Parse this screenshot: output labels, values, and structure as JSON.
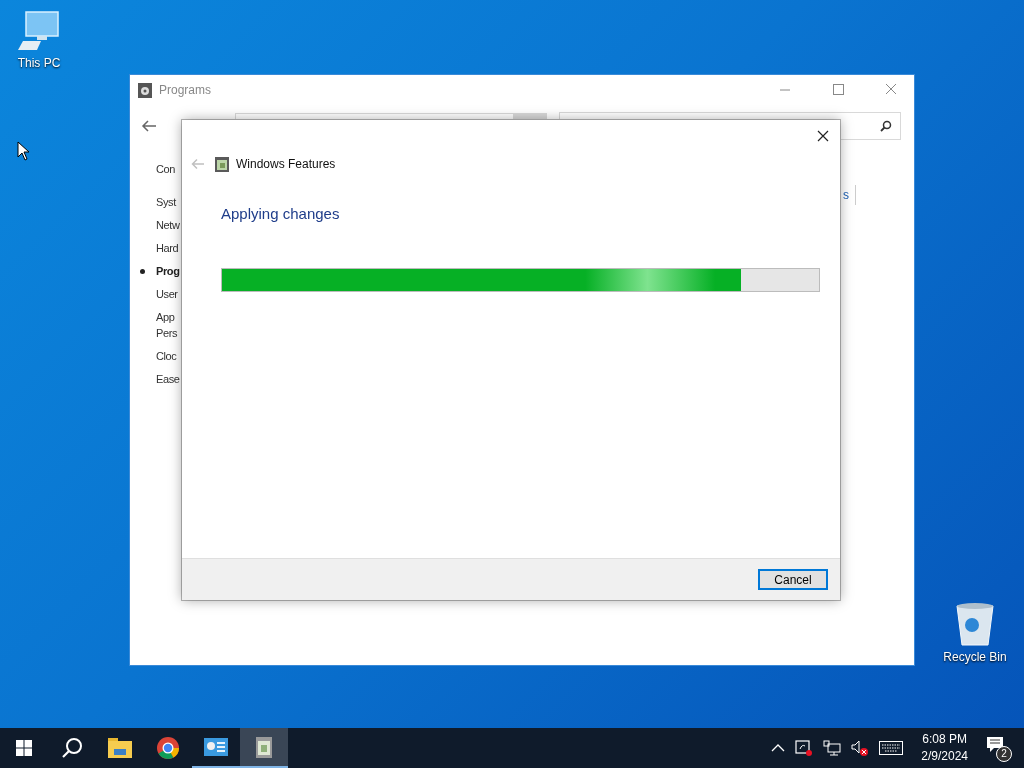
{
  "desktop_icons": [
    {
      "kind": "computer",
      "label": "This PC"
    },
    {
      "kind": "recycle",
      "label": "Recycle Bin"
    }
  ],
  "programs_window": {
    "title": "Programs",
    "sidebar_items": [
      {
        "lines": [
          "Con"
        ],
        "selected": false
      },
      {
        "lines": [
          "Syst"
        ],
        "selected": false
      },
      {
        "lines": [
          "Netw"
        ],
        "selected": false
      },
      {
        "lines": [
          "Hard"
        ],
        "selected": false
      },
      {
        "lines": [
          "Prog"
        ],
        "selected": true
      },
      {
        "lines": [
          "User"
        ],
        "selected": false
      },
      {
        "lines": [
          "App",
          "Pers"
        ],
        "selected": false
      },
      {
        "lines": [
          "Cloc"
        ],
        "selected": false
      },
      {
        "lines": [
          "Ease"
        ],
        "selected": false
      }
    ],
    "link_fragment": "s"
  },
  "dialog": {
    "title": "Windows Features",
    "heading": "Applying changes",
    "progress": {
      "level": 0.87
    },
    "buttons": [
      "Cancel"
    ]
  },
  "taskbar": {
    "apps": [
      {
        "kind": "folder",
        "running": false,
        "selected": false
      },
      {
        "kind": "browser",
        "running": false,
        "selected": false
      },
      {
        "kind": "control-panel",
        "running": true,
        "selected": false
      },
      {
        "kind": "features",
        "running": true,
        "selected": true
      }
    ],
    "clock": {
      "time": "6:08 PM",
      "date": "2/9/2024"
    },
    "notification_count": "2"
  }
}
